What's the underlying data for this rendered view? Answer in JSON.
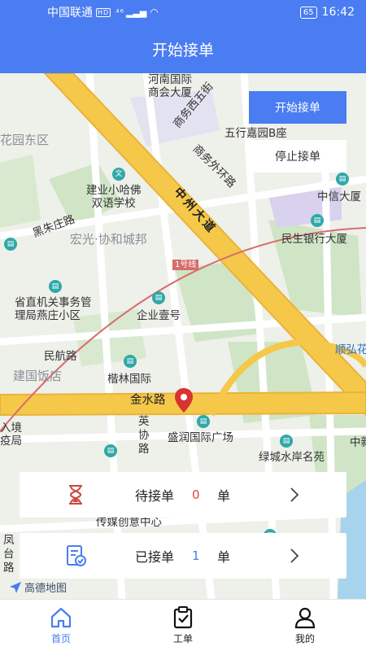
{
  "status_bar": {
    "carrier": "中国联通",
    "hd": "HD",
    "network": "⁴⁶",
    "battery": "65",
    "time": "16:42"
  },
  "header": {
    "title": "开始接单"
  },
  "map": {
    "labels": {
      "henan_center": "河南国际\n商会大厦",
      "shangwu_5": "商务西五街",
      "wuhang": "五行嘉园B座",
      "shangwu_wai": "商务外环路",
      "huayuan": "花园东区",
      "jianye": "建业小哈佛\n双语学校",
      "zhongzhou": "中州大道",
      "zhongxin": "中信大厦",
      "heizhu": "黑朱庄路",
      "hongguang": "宏光·协和城邦",
      "minsheng": "民生银行大厦",
      "line1": "1号线",
      "shengzhi": "省直机关事务管\n理局燕庄小区",
      "qiye": "企业壹号",
      "minhang": "民航路",
      "jianguo": "建国饭店",
      "kailin": "楷林国际",
      "shunhong": "顺弘花",
      "jinshui": "金水路",
      "ruxie": "英\n协\n路",
      "shengrun": "盛润国际广场",
      "rujing": "入境\n疫局",
      "lvcheng": "绿城水岸名苑",
      "chuanmei": "传媒创意中心",
      "fengtai": "凤\n台\n路",
      "zhong": "中新"
    },
    "logo": "高德地图"
  },
  "actions": {
    "start": "开始接单",
    "stop": "停止接单"
  },
  "cards": [
    {
      "label": "待接单",
      "count": "0",
      "unit": "单",
      "count_color": "#e0463b"
    },
    {
      "label": "已接单",
      "count": "1",
      "unit": "单",
      "count_color": "#4a7cf2"
    }
  ],
  "tabs": [
    {
      "label": "首页"
    },
    {
      "label": "工单"
    },
    {
      "label": "我的"
    }
  ],
  "colors": {
    "primary": "#4a7cf2",
    "pending": "#e0463b",
    "road": "#f5c84a"
  }
}
